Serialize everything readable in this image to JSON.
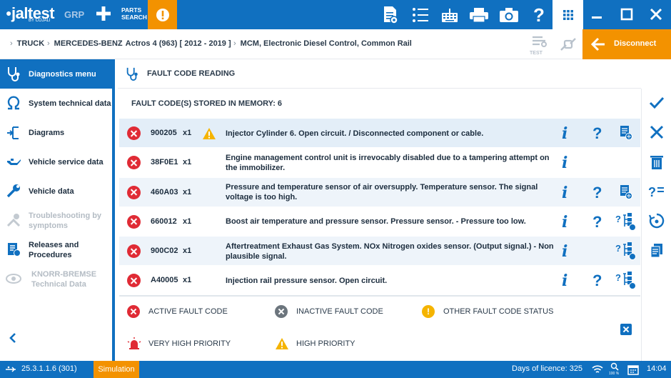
{
  "topbar": {
    "logo": "jaltest",
    "logo_sub": "BY COJALI",
    "grp": "GRP",
    "parts_line1": "PARTS",
    "parts_line2": "SEARCH"
  },
  "breadcrumb": [
    "TRUCK",
    "MERCEDES-BENZ",
    "Actros 4 (963) [ 2012 - 2019 ]",
    "MCM, Electronic Diesel Control, Common Rail"
  ],
  "test_label": "TEST",
  "disconnect_label": "Disconnect",
  "sidebar": {
    "items": [
      {
        "label": "Diagnostics menu",
        "icon": "stethoscope-icon",
        "state": "active"
      },
      {
        "label": "System technical data",
        "icon": "ohm-icon",
        "state": "normal"
      },
      {
        "label": "Diagrams",
        "icon": "diagram-icon",
        "state": "normal"
      },
      {
        "label": "Vehicle service data",
        "icon": "oil-can-icon",
        "state": "normal"
      },
      {
        "label": "Vehicle data",
        "icon": "wrench-icon",
        "state": "normal"
      },
      {
        "label": "Troubleshooting by symptoms",
        "icon": "tools-icon",
        "state": "disabled"
      },
      {
        "label": "Releases and Procedures",
        "icon": "procedures-icon",
        "state": "normal"
      },
      {
        "label": "KNORR-BREMSE Technical Data",
        "icon": "knorr-icon",
        "state": "disabled"
      }
    ]
  },
  "main": {
    "title": "FAULT CODE READING",
    "stored_label": "FAULT CODE(S) STORED IN MEMORY: 6"
  },
  "faults": [
    {
      "code": "900205",
      "count": "x1",
      "warn": true,
      "desc": "Injector Cylinder 6. Open circuit. / Disconnected component or cable.",
      "info": "i",
      "help": "?",
      "action": "doc"
    },
    {
      "code": "38F0E1",
      "count": "x1",
      "warn": false,
      "desc": "Engine management control unit is irrevocably disabled due to a tampering attempt on the immobilizer.",
      "info": "i",
      "help": "",
      "action": ""
    },
    {
      "code": "460A03",
      "count": "x1",
      "warn": false,
      "desc": "Pressure and temperature sensor of air oversupply. Temperature sensor. The signal voltage is too high.",
      "info": "i",
      "help": "?",
      "action": "doc"
    },
    {
      "code": "660012",
      "count": "x1",
      "warn": false,
      "desc": "Boost air temperature and pressure sensor. Pressure sensor. - Pressure too low.",
      "info": "i",
      "help": "?",
      "action": "tree"
    },
    {
      "code": "900C02",
      "count": "x1",
      "warn": false,
      "desc": "Aftertreatment Exhaust Gas System. NOx Nitrogen oxides sensor. (Output signal.) - Non plausible signal.",
      "info": "i",
      "help": "",
      "action": "tree"
    },
    {
      "code": "A40005",
      "count": "x1",
      "warn": false,
      "desc": "Injection rail pressure sensor. Open circuit.",
      "info": "i",
      "help": "?",
      "action": "tree"
    }
  ],
  "legend": {
    "active": "ACTIVE FAULT CODE",
    "inactive": "INACTIVE FAULT CODE",
    "other": "OTHER FAULT CODE STATUS",
    "very_high": "VERY HIGH PRIORITY",
    "high": "HIGH PRIORITY"
  },
  "status": {
    "version": "25.3.1.1.6 (301)",
    "mode": "Simulation",
    "licence": "Days of licence: 325",
    "zoom": "100 %",
    "time": "14:04"
  },
  "colors": {
    "brand_blue": "#1070c0",
    "accent_orange": "#f39200",
    "error_red": "#e02b35"
  }
}
